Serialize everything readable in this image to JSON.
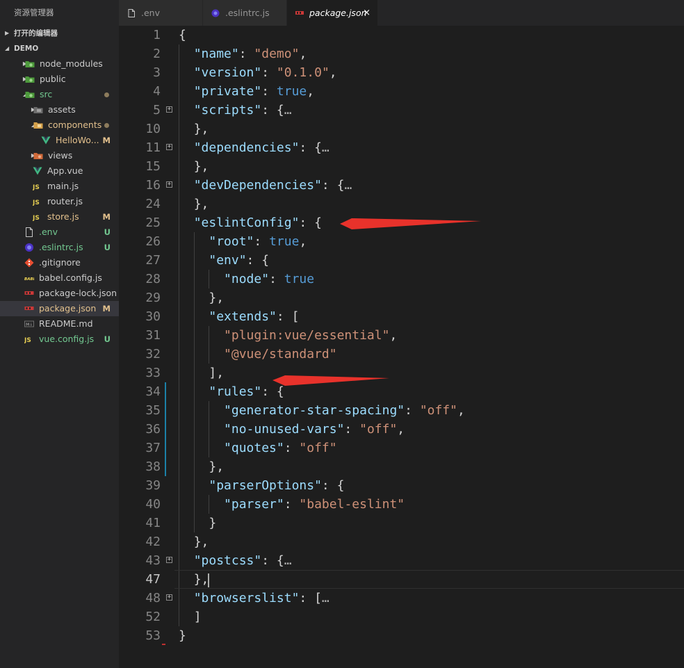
{
  "explorer": {
    "title": "资源管理器",
    "open_editors_label": "打开的编辑器",
    "project_label": "DEMO",
    "items": [
      {
        "name": "node_modules",
        "depth": 1,
        "twisty": "collapsed",
        "icon": "node-folder-icon",
        "color": "#cccccc",
        "badge": ""
      },
      {
        "name": "public",
        "depth": 1,
        "twisty": "collapsed",
        "icon": "public-folder-icon",
        "color": "#cccccc",
        "badge": ""
      },
      {
        "name": "src",
        "depth": 1,
        "twisty": "expanded",
        "icon": "src-folder-icon",
        "color": "#73c991",
        "badge": "dot"
      },
      {
        "name": "assets",
        "depth": 2,
        "twisty": "collapsed",
        "icon": "assets-folder-icon",
        "color": "#cccccc",
        "badge": ""
      },
      {
        "name": "components",
        "depth": 2,
        "twisty": "expanded",
        "icon": "components-folder-icon",
        "color": "#e2c08d",
        "badge": "dot"
      },
      {
        "name": "HelloWo...",
        "depth": 3,
        "twisty": "",
        "icon": "vue-file-icon",
        "color": "#e2c08d",
        "badge": "M"
      },
      {
        "name": "views",
        "depth": 2,
        "twisty": "collapsed",
        "icon": "views-folder-icon",
        "color": "#cccccc",
        "badge": ""
      },
      {
        "name": "App.vue",
        "depth": 2,
        "twisty": "",
        "icon": "vue-file-icon",
        "color": "#cccccc",
        "badge": ""
      },
      {
        "name": "main.js",
        "depth": 2,
        "twisty": "",
        "icon": "js-file-icon",
        "color": "#cccccc",
        "badge": ""
      },
      {
        "name": "router.js",
        "depth": 2,
        "twisty": "",
        "icon": "js-file-icon",
        "color": "#cccccc",
        "badge": ""
      },
      {
        "name": "store.js",
        "depth": 2,
        "twisty": "",
        "icon": "js-file-icon",
        "color": "#e2c08d",
        "badge": "M"
      },
      {
        "name": ".env",
        "depth": 1,
        "twisty": "",
        "icon": "file-icon",
        "color": "#73c991",
        "badge": "U"
      },
      {
        "name": ".eslintrc.js",
        "depth": 1,
        "twisty": "",
        "icon": "eslint-file-icon",
        "color": "#73c991",
        "badge": "U"
      },
      {
        "name": ".gitignore",
        "depth": 1,
        "twisty": "",
        "icon": "git-file-icon",
        "color": "#cccccc",
        "badge": ""
      },
      {
        "name": "babel.config.js",
        "depth": 1,
        "twisty": "",
        "icon": "babel-file-icon",
        "color": "#cccccc",
        "badge": ""
      },
      {
        "name": "package-lock.json",
        "depth": 1,
        "twisty": "",
        "icon": "npm-file-icon",
        "color": "#cccccc",
        "badge": ""
      },
      {
        "name": "package.json",
        "depth": 1,
        "twisty": "",
        "icon": "npm-file-icon",
        "color": "#e2c08d",
        "badge": "M",
        "selected": true
      },
      {
        "name": "README.md",
        "depth": 1,
        "twisty": "",
        "icon": "markdown-file-icon",
        "color": "#cccccc",
        "badge": ""
      },
      {
        "name": "vue.config.js",
        "depth": 1,
        "twisty": "",
        "icon": "js-file-icon",
        "color": "#73c991",
        "badge": "U"
      }
    ]
  },
  "tabs": [
    {
      "label": ".env",
      "icon": "file-icon",
      "active": false
    },
    {
      "label": ".eslintrc.js",
      "icon": "eslint-file-icon",
      "active": false
    },
    {
      "label": "package.json",
      "icon": "npm-file-icon",
      "active": true,
      "close": "×"
    }
  ],
  "editor": {
    "lines": [
      {
        "n": "1",
        "indent": 0,
        "t": [
          [
            "p",
            "{"
          ]
        ]
      },
      {
        "n": "2",
        "indent": 1,
        "t": [
          [
            "k",
            "\"name\""
          ],
          [
            "p",
            ": "
          ],
          [
            "s",
            "\"demo\""
          ],
          [
            "p",
            ","
          ]
        ]
      },
      {
        "n": "3",
        "indent": 1,
        "t": [
          [
            "k",
            "\"version\""
          ],
          [
            "p",
            ": "
          ],
          [
            "s",
            "\"0.1.0\""
          ],
          [
            "p",
            ","
          ]
        ]
      },
      {
        "n": "4",
        "indent": 1,
        "t": [
          [
            "k",
            "\"private\""
          ],
          [
            "p",
            ": "
          ],
          [
            "b",
            "true"
          ],
          [
            "p",
            ","
          ]
        ]
      },
      {
        "n": "5",
        "indent": 1,
        "fold": true,
        "t": [
          [
            "k",
            "\"scripts\""
          ],
          [
            "p",
            ": {"
          ],
          [
            "e",
            "…"
          ]
        ]
      },
      {
        "n": "10",
        "indent": 1,
        "t": [
          [
            "p",
            "},"
          ]
        ]
      },
      {
        "n": "11",
        "indent": 1,
        "fold": true,
        "t": [
          [
            "k",
            "\"dependencies\""
          ],
          [
            "p",
            ": {"
          ],
          [
            "e",
            "…"
          ]
        ]
      },
      {
        "n": "15",
        "indent": 1,
        "t": [
          [
            "p",
            "},"
          ]
        ]
      },
      {
        "n": "16",
        "indent": 1,
        "fold": true,
        "t": [
          [
            "k",
            "\"devDependencies\""
          ],
          [
            "p",
            ": {"
          ],
          [
            "e",
            "…"
          ]
        ]
      },
      {
        "n": "24",
        "indent": 1,
        "t": [
          [
            "p",
            "},"
          ]
        ]
      },
      {
        "n": "25",
        "indent": 1,
        "t": [
          [
            "k",
            "\"eslintConfig\""
          ],
          [
            "p",
            ": {"
          ]
        ]
      },
      {
        "n": "26",
        "indent": 2,
        "t": [
          [
            "k",
            "\"root\""
          ],
          [
            "p",
            ": "
          ],
          [
            "b",
            "true"
          ],
          [
            "p",
            ","
          ]
        ]
      },
      {
        "n": "27",
        "indent": 2,
        "t": [
          [
            "k",
            "\"env\""
          ],
          [
            "p",
            ": {"
          ]
        ]
      },
      {
        "n": "28",
        "indent": 3,
        "t": [
          [
            "k",
            "\"node\""
          ],
          [
            "p",
            ": "
          ],
          [
            "b",
            "true"
          ]
        ]
      },
      {
        "n": "29",
        "indent": 2,
        "t": [
          [
            "p",
            "},"
          ]
        ]
      },
      {
        "n": "30",
        "indent": 2,
        "t": [
          [
            "k",
            "\"extends\""
          ],
          [
            "p",
            ": ["
          ]
        ]
      },
      {
        "n": "31",
        "indent": 3,
        "t": [
          [
            "s",
            "\"plugin:vue/essential\""
          ],
          [
            "p",
            ","
          ]
        ]
      },
      {
        "n": "32",
        "indent": 3,
        "t": [
          [
            "s",
            "\"@vue/standard\""
          ]
        ]
      },
      {
        "n": "33",
        "indent": 2,
        "t": [
          [
            "p",
            "],"
          ]
        ]
      },
      {
        "n": "34",
        "indent": 2,
        "t": [
          [
            "k",
            "\"rules\""
          ],
          [
            "p",
            ": {"
          ]
        ]
      },
      {
        "n": "35",
        "indent": 3,
        "t": [
          [
            "k",
            "\"generator-star-spacing\""
          ],
          [
            "p",
            ": "
          ],
          [
            "s",
            "\"off\""
          ],
          [
            "p",
            ","
          ]
        ]
      },
      {
        "n": "36",
        "indent": 3,
        "t": [
          [
            "k",
            "\"no-unused-vars\""
          ],
          [
            "p",
            ": "
          ],
          [
            "s",
            "\"off\""
          ],
          [
            "p",
            ","
          ]
        ]
      },
      {
        "n": "37",
        "indent": 3,
        "t": [
          [
            "k",
            "\"quotes\""
          ],
          [
            "p",
            ": "
          ],
          [
            "s",
            "\"off\""
          ]
        ]
      },
      {
        "n": "38",
        "indent": 2,
        "t": [
          [
            "p",
            "},"
          ]
        ]
      },
      {
        "n": "39",
        "indent": 2,
        "t": [
          [
            "k",
            "\"parserOptions\""
          ],
          [
            "p",
            ": {"
          ]
        ]
      },
      {
        "n": "40",
        "indent": 3,
        "t": [
          [
            "k",
            "\"parser\""
          ],
          [
            "p",
            ": "
          ],
          [
            "s",
            "\"babel-eslint\""
          ]
        ]
      },
      {
        "n": "41",
        "indent": 2,
        "t": [
          [
            "p",
            "}"
          ]
        ]
      },
      {
        "n": "42",
        "indent": 1,
        "t": [
          [
            "p",
            "},"
          ]
        ]
      },
      {
        "n": "43",
        "indent": 1,
        "fold": true,
        "t": [
          [
            "k",
            "\"postcss\""
          ],
          [
            "p",
            ": {"
          ],
          [
            "e",
            "…"
          ]
        ]
      },
      {
        "n": "47",
        "indent": 1,
        "current": true,
        "t": [
          [
            "p",
            "},"
          ]
        ]
      },
      {
        "n": "48",
        "indent": 1,
        "fold": true,
        "t": [
          [
            "k",
            "\"browserslist\""
          ],
          [
            "p",
            ": ["
          ],
          [
            "e",
            "…"
          ]
        ]
      },
      {
        "n": "52",
        "indent": 1,
        "t": [
          [
            "p",
            "]"
          ]
        ]
      },
      {
        "n": "53",
        "indent": 0,
        "t": [
          [
            "p",
            "}"
          ]
        ]
      }
    ]
  },
  "colors": {
    "key": "#9cdcfe",
    "string": "#ce9178",
    "boolean": "#569cd6",
    "punct": "#d4d4d4",
    "modified": "#e2c08d",
    "untracked": "#73c991",
    "arrow": "#e8322b"
  }
}
